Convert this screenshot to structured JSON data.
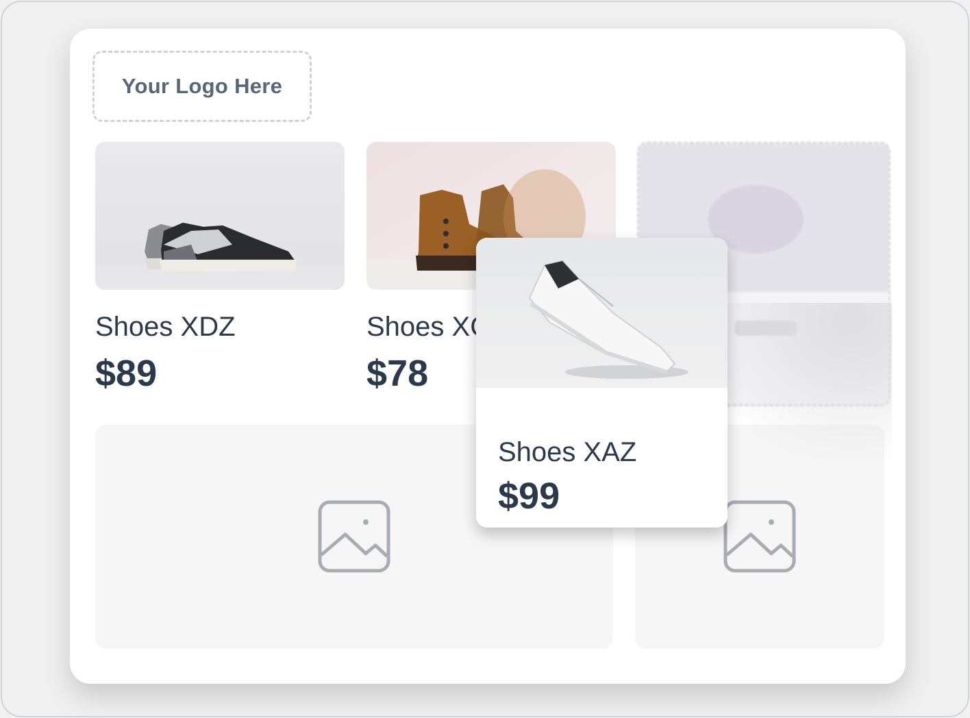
{
  "logo": {
    "text": "Your Logo Here"
  },
  "products": [
    {
      "name": "Shoes XDZ",
      "price": "$89",
      "image_icon": "sneaker-grey-image"
    },
    {
      "name": "Shoes XC",
      "price": "$78",
      "image_icon": "brown-boot-image"
    }
  ],
  "dragged_product": {
    "name": "Shoes XAZ",
    "price": "$99",
    "image_icon": "white-sneaker-image"
  },
  "placeholders": [
    {
      "icon": "image-placeholder-icon"
    },
    {
      "icon": "image-placeholder-icon"
    }
  ],
  "colors": {
    "text": "#2b3a4b",
    "logo_text": "#56677a",
    "placeholder_bg": "#f6f6f6",
    "placeholder_icon": "#a8adb3"
  }
}
